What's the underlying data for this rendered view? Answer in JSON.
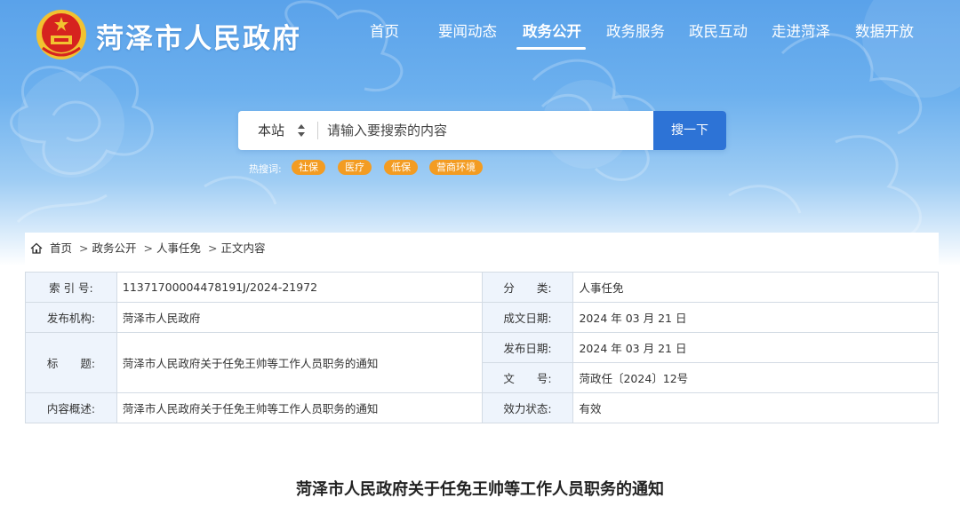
{
  "site": {
    "title": "菏泽市人民政府"
  },
  "nav": {
    "items": [
      {
        "label": "首页"
      },
      {
        "label": "要闻动态"
      },
      {
        "label": "政务公开"
      },
      {
        "label": "政务服务"
      },
      {
        "label": "政民互动"
      },
      {
        "label": "走进菏泽"
      },
      {
        "label": "数据开放"
      }
    ],
    "active": "政务公开"
  },
  "search": {
    "scope": "本站",
    "placeholder": "请输入要搜索的内容",
    "button": "搜一下"
  },
  "hot": {
    "label": "热搜词:",
    "tags": [
      "社保",
      "医疗",
      "低保",
      "营商环境"
    ]
  },
  "breadcrumb": {
    "items": [
      "首页",
      "政务公开",
      "人事任免",
      "正文内容"
    ],
    "separator": ">"
  },
  "meta": {
    "index_label": "索 引 号:",
    "index_value": "11371700004478191J/2024-21972",
    "category_label": "分　　类:",
    "category_value": "人事任免",
    "publisher_label": "发布机构:",
    "publisher_value": "菏泽市人民政府",
    "created_label": "成文日期:",
    "created_value": "2024 年 03 月 21 日",
    "title_label": "标　　题:",
    "title_value": "菏泽市人民政府关于任免王帅等工作人员职务的通知",
    "published_label": "发布日期:",
    "published_value": "2024 年 03 月 21 日",
    "docno_label": "文　　号:",
    "docno_value": "菏政任〔2024〕12号",
    "summary_label": "内容概述:",
    "summary_value": "菏泽市人民政府关于任免王帅等工作人员职务的通知",
    "status_label": "效力状态:",
    "status_value": "有效"
  },
  "document": {
    "title": "菏泽市人民政府关于任免王帅等工作人员职务的通知"
  },
  "colors": {
    "banner": "#5aa2ea",
    "search_button": "#2d73d6",
    "hot_tag": "#f39c22",
    "table_label_bg": "#eef4fc",
    "emblem_red": "#d6231f",
    "emblem_gold": "#f2c230"
  }
}
